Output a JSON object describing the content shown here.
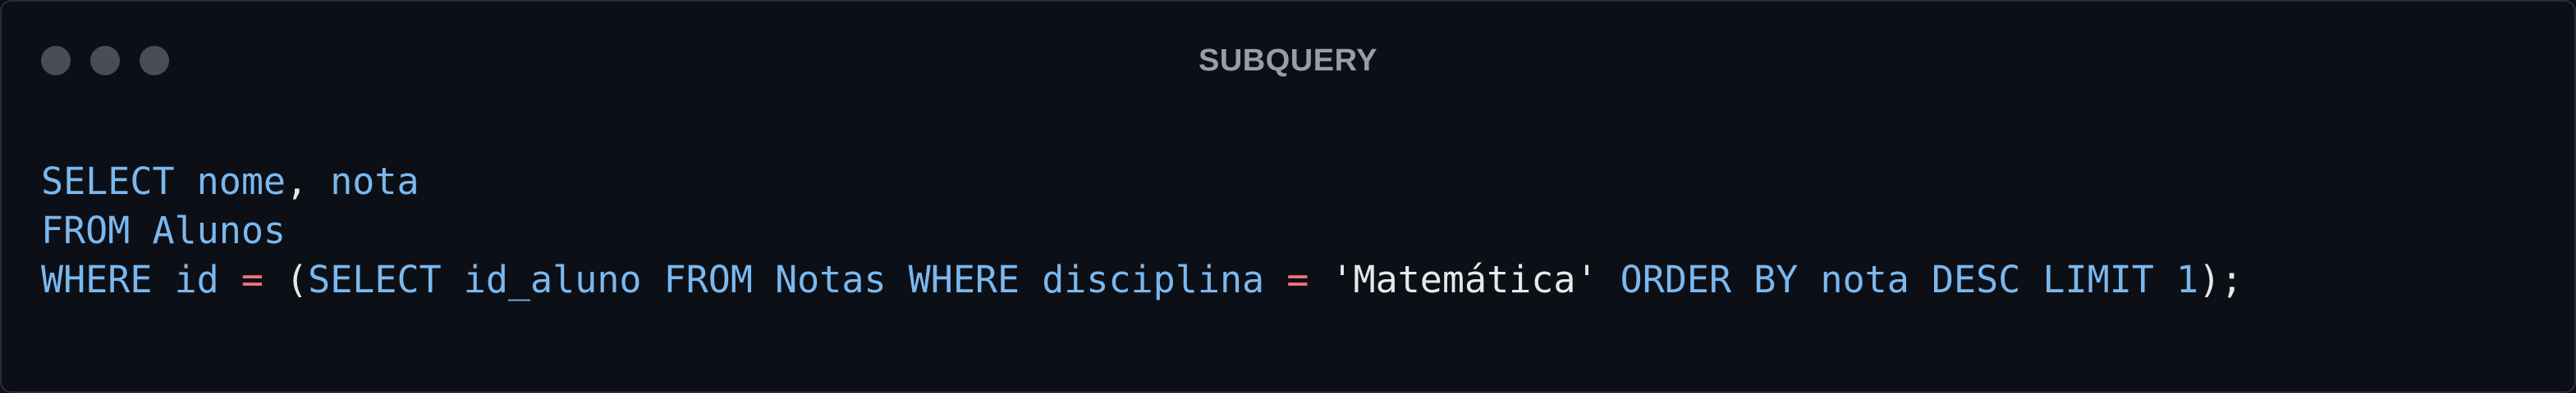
{
  "window": {
    "title": "SUBQUERY"
  },
  "colors": {
    "background": "#0d0f16",
    "keyword": "#7ab8ef",
    "operator": "#f0707a",
    "text": "#e6e8ee",
    "title": "#9a9ca6",
    "window_dot": "#4b4d55"
  },
  "code": {
    "language": "SQL",
    "lines": [
      {
        "tokens": [
          {
            "type": "kw",
            "text": "SELECT"
          },
          {
            "type": "pn",
            "text": " "
          },
          {
            "type": "id",
            "text": "nome"
          },
          {
            "type": "pn",
            "text": ", "
          },
          {
            "type": "id",
            "text": "nota"
          }
        ]
      },
      {
        "tokens": [
          {
            "type": "kw",
            "text": "FROM"
          },
          {
            "type": "pn",
            "text": " "
          },
          {
            "type": "id",
            "text": "Alunos"
          }
        ]
      },
      {
        "tokens": [
          {
            "type": "kw",
            "text": "WHERE"
          },
          {
            "type": "pn",
            "text": " "
          },
          {
            "type": "id",
            "text": "id"
          },
          {
            "type": "pn",
            "text": " "
          },
          {
            "type": "op",
            "text": "="
          },
          {
            "type": "pn",
            "text": " ("
          },
          {
            "type": "kw",
            "text": "SELECT"
          },
          {
            "type": "pn",
            "text": " "
          },
          {
            "type": "id",
            "text": "id_aluno"
          },
          {
            "type": "pn",
            "text": " "
          },
          {
            "type": "kw",
            "text": "FROM"
          },
          {
            "type": "pn",
            "text": " "
          },
          {
            "type": "id",
            "text": "Notas"
          },
          {
            "type": "pn",
            "text": " "
          },
          {
            "type": "kw",
            "text": "WHERE"
          },
          {
            "type": "pn",
            "text": " "
          },
          {
            "type": "id",
            "text": "disciplina"
          },
          {
            "type": "pn",
            "text": " "
          },
          {
            "type": "op",
            "text": "="
          },
          {
            "type": "pn",
            "text": " "
          },
          {
            "type": "str",
            "text": "'Matemática'"
          },
          {
            "type": "pn",
            "text": " "
          },
          {
            "type": "kw",
            "text": "ORDER BY"
          },
          {
            "type": "pn",
            "text": " "
          },
          {
            "type": "id",
            "text": "nota"
          },
          {
            "type": "pn",
            "text": " "
          },
          {
            "type": "kw",
            "text": "DESC"
          },
          {
            "type": "pn",
            "text": " "
          },
          {
            "type": "kw",
            "text": "LIMIT"
          },
          {
            "type": "pn",
            "text": " "
          },
          {
            "type": "num",
            "text": "1"
          },
          {
            "type": "pn",
            "text": ");"
          }
        ]
      }
    ]
  }
}
